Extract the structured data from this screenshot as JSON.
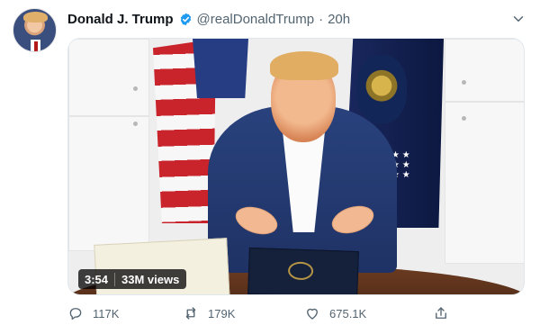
{
  "tweet": {
    "author": {
      "name": "Donald J. Trump",
      "handle": "@realDonaldTrump",
      "verified": true
    },
    "time_separator": "·",
    "relative_time": "20h"
  },
  "media": {
    "duration": "3:54",
    "views": "33M views"
  },
  "actions": {
    "replies": "117K",
    "retweets": "179K",
    "likes": "675.1K"
  },
  "icons": {
    "verified": "verified-badge-icon",
    "menu": "chevron-down-icon",
    "reply": "reply-icon",
    "retweet": "retweet-icon",
    "like": "heart-icon",
    "share": "share-icon"
  },
  "colors": {
    "text_primary": "#0f1419",
    "text_secondary": "#536471",
    "verified_blue": "#1d9bf0"
  }
}
